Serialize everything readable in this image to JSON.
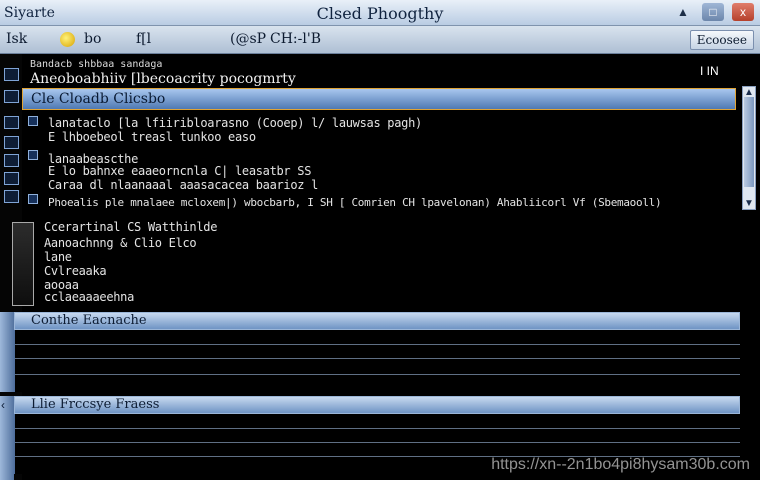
{
  "window": {
    "app_label": "Siyarte",
    "title": "Clsed Phoogthy",
    "min_label": "▲",
    "max_label": "□",
    "close_label": "x"
  },
  "toolbar": {
    "item1": "Isk",
    "item2": "bo",
    "item3": "f[l",
    "item4": "(@sP",
    "item5": "CH:-l'B",
    "right_button": "Ecoosee"
  },
  "pane": {
    "header_small": "Bandacb shbbaa sandaga",
    "header_main": "Aneoboabhiiv [lbecoacrity pocogmrty",
    "right_text": "I  IN"
  },
  "selected_row": {
    "label": "Cle Cloadb Clicsbo"
  },
  "rows": [
    "lanataclo [la lfiiribloarasno (Cooep) l/ lauwsas pagh)",
    "E lhboebeol treasl tunkoo easo",
    "lanaabeascthe",
    "E lo bahnxe eaaeorncnla C| leasatbr SS",
    "Caraa dl nlaanaaal aaasacacea baarioz l",
    "Phoealis ple mnalaee mcloxem|) wbocbarb, I SH [ Comrien CH lpavelonan) Ahabliicorl Vf (Sbemaooll)"
  ],
  "group2": {
    "title": "Ccerartinal CS Watthinlde",
    "lines": [
      "Aanoachnng & Clio Elco",
      "lane",
      "Cvlreaaka",
      "aooaa",
      "cclaeaaaeehna"
    ]
  },
  "panel1": {
    "label": "Conthe Eacnache"
  },
  "panel2": {
    "label": "Llie Frccsye Fraess"
  },
  "watermark": "https://xn--2n1bo4pi8hysam30b.com"
}
